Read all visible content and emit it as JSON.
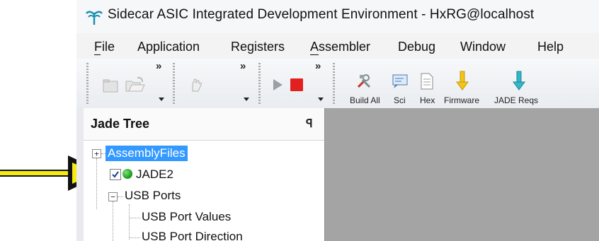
{
  "window": {
    "title": "Sidecar ASIC Integrated Development Environment - HxRG@localhost"
  },
  "menu": [
    "File",
    "Application",
    "Registers",
    "Assembler",
    "Debug",
    "Window",
    "Help"
  ],
  "toolbar": {
    "buttons": [
      {
        "label": "Build All",
        "icon": "build-icon"
      },
      {
        "label": "Sci",
        "icon": "sci-icon"
      },
      {
        "label": "Hex",
        "icon": "hex-icon"
      },
      {
        "label": "Firmware",
        "icon": "firmware-download-icon"
      },
      {
        "label": "JADE Reqs",
        "icon": "jade-reqs-download-icon"
      }
    ],
    "overflow_symbol": "»"
  },
  "panel": {
    "title": "Jade Tree",
    "pin_symbol": "ꟼ"
  },
  "tree": {
    "root": "AssemblyFiles",
    "node": "JADE2",
    "group": "USB Ports",
    "children": [
      "USB Port Values",
      "USB Port Direction"
    ]
  },
  "colors": {
    "accent": "#3399ff",
    "stop": "#e32020",
    "play": "#9aa0a6",
    "arrow": "#f5ea12",
    "status": "#1fa31f"
  }
}
